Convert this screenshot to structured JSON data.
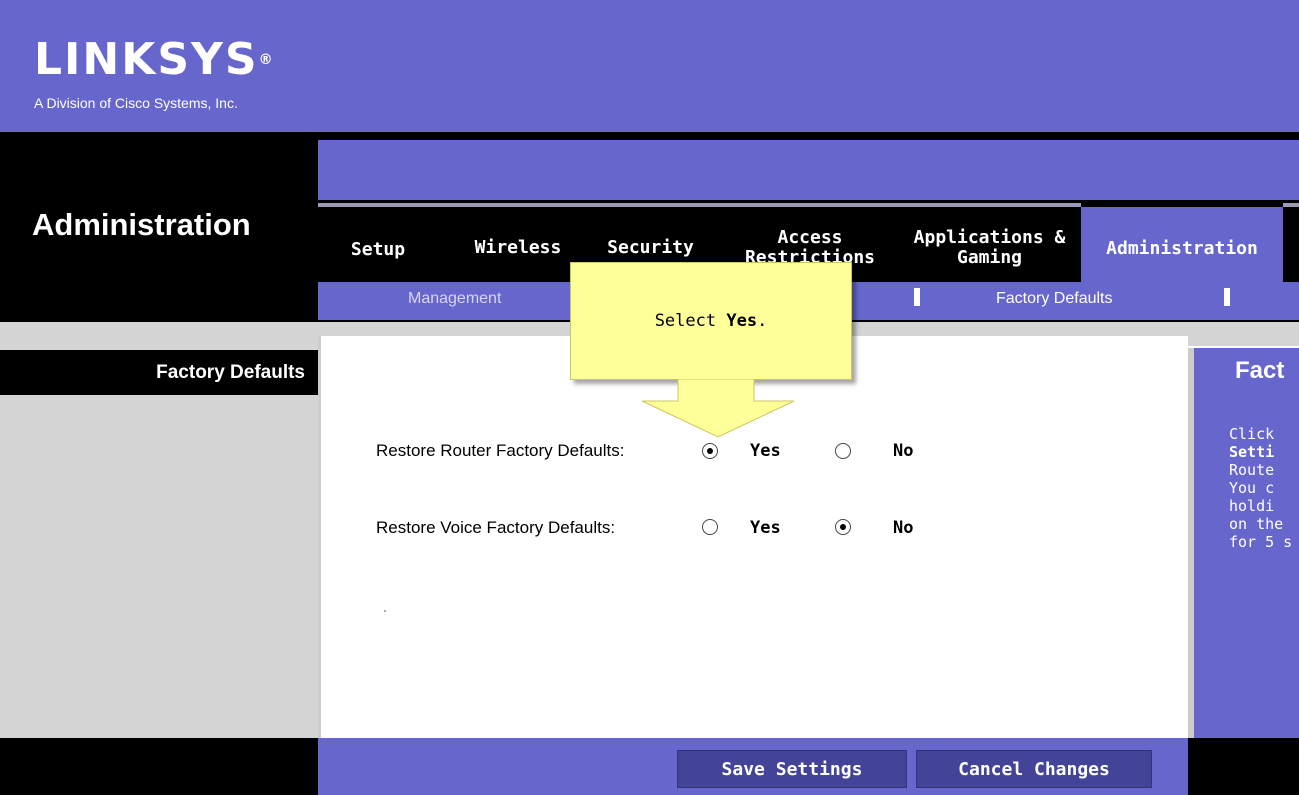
{
  "header": {
    "logo": "LINKSYS",
    "logo_mark": "®",
    "tagline": "A Division of Cisco Systems, Inc."
  },
  "section_title": "Administration",
  "tabs": [
    {
      "label": "Setup"
    },
    {
      "label": "Wireless"
    },
    {
      "label": "Security"
    },
    {
      "label": "Access Restrictions"
    },
    {
      "label": "Applications & Gaming"
    },
    {
      "label": "Administration",
      "active": true
    }
  ],
  "subnav": {
    "items": [
      "Management",
      "Factory Defaults"
    ],
    "active": "Factory Defaults"
  },
  "sidebar": {
    "title": "Factory Defaults"
  },
  "form": {
    "router_label": "Restore Router Factory Defaults:",
    "voice_label": "Restore Voice Factory Defaults:",
    "yes": "Yes",
    "no": "No",
    "router_selected": "Yes",
    "voice_selected": "No"
  },
  "help": {
    "title": "Fact",
    "lines": [
      "Click",
      "Setti",
      "Route",
      "You c",
      "holdi",
      "on the",
      "for 5 s"
    ]
  },
  "buttons": {
    "save": "Save Settings",
    "cancel": "Cancel Changes"
  },
  "callout": {
    "prefix": "Select ",
    "bold": "Yes",
    "suffix": "."
  },
  "colors": {
    "brand_purple": "#6666cc",
    "button_purple": "#434398",
    "callout_yellow": "#ffff99"
  }
}
